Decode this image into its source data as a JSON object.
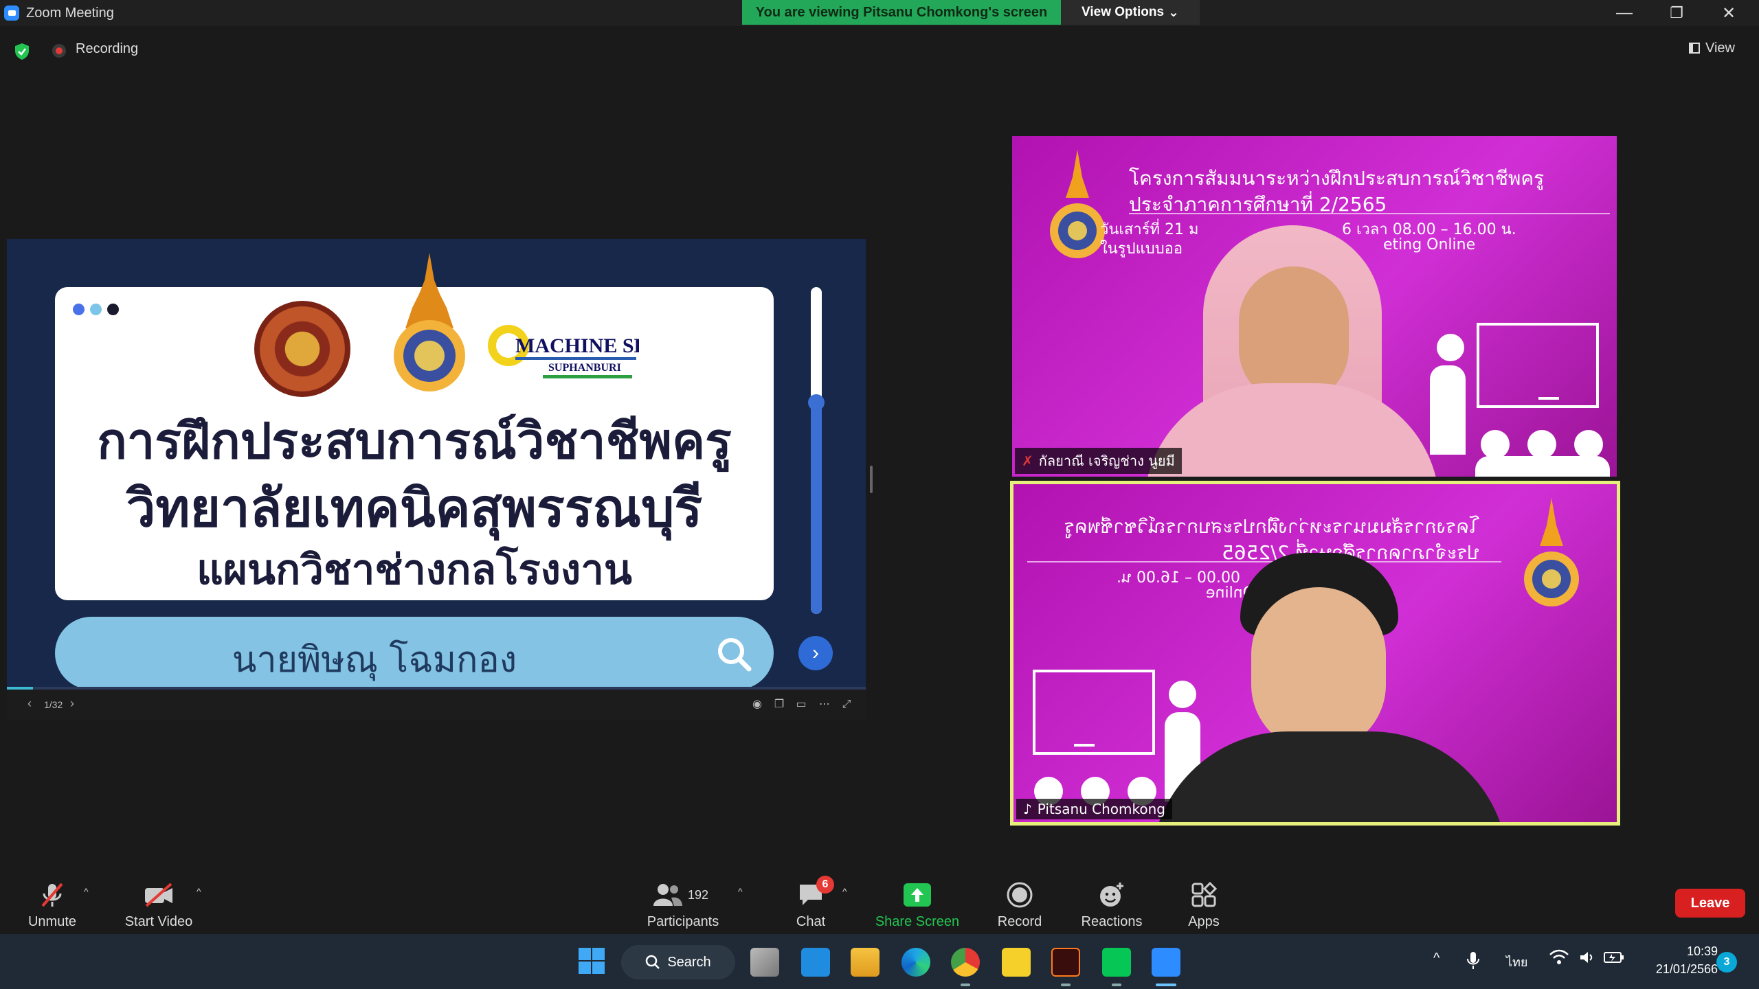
{
  "window": {
    "title": "Zoom Meeting"
  },
  "banner": {
    "viewing_text": "You are viewing Pitsanu Chomkong's screen",
    "view_options_label": "View Options",
    "view_options_caret": "⌄"
  },
  "window_controls": {
    "minimize": "—",
    "restore": "❐",
    "close": "✕"
  },
  "header": {
    "recording_label": "Recording",
    "view_label": "View"
  },
  "slide": {
    "logo_machine_shop": "MACHINE SHOP",
    "logo_suphanburi": "SUPHANBURI",
    "line1": "การฝึกประสบการณ์วิชาชีพครู",
    "line2": "วิทยาลัยเทคนิคสุพรรณบุรี",
    "line3": "แผนกวิชาช่างกลโรงงาน",
    "search_text": "นายพิษณุ   โฉมกอง",
    "page_indicator": "1/32",
    "prev_glyph": "‹",
    "next_glyph": "›"
  },
  "videos": [
    {
      "name": "กัลยาณี เจริญช่าง นูยมี",
      "bg_line1": "โครงการสัมมนาระหว่างฝึกประสบการณ์วิชาชีพครู",
      "bg_line2": "ประจำภาคการศึกษาที่ 2/2565",
      "bg_line3": "วันเสาร์ที่ 21 ม",
      "bg_line3b": "6 เวลา 08.00 – 16.00 น.",
      "bg_line4": "ในรูปแบบออ",
      "bg_line4b": "eting Online"
    },
    {
      "name": "Pitsanu Chomkong",
      "bg_line1": "โครงการสัมมนาระหว่างฝึกประสบการณ์วิชาชีพครู",
      "bg_line2": "ประจำภาคการศึกษาที่ 2/2565",
      "bg_line3": "00.00 – 16.00 น.",
      "bg_line4": "Online",
      "active_speaker_color": "#e7f07a"
    }
  ],
  "toolbar": {
    "unmute": "Unmute",
    "start_video": "Start Video",
    "participants": "Participants",
    "participants_count": "192",
    "chat": "Chat",
    "chat_badge": "6",
    "share_screen": "Share Screen",
    "record": "Record",
    "reactions": "Reactions",
    "apps": "Apps",
    "leave": "Leave",
    "caret": "^",
    "share_color": "#23c552"
  },
  "taskbar": {
    "search_label": "Search",
    "lang": "ไทย",
    "time": "10:39",
    "date": "21/01/2566",
    "notifications": "3",
    "caret_up": "^"
  }
}
